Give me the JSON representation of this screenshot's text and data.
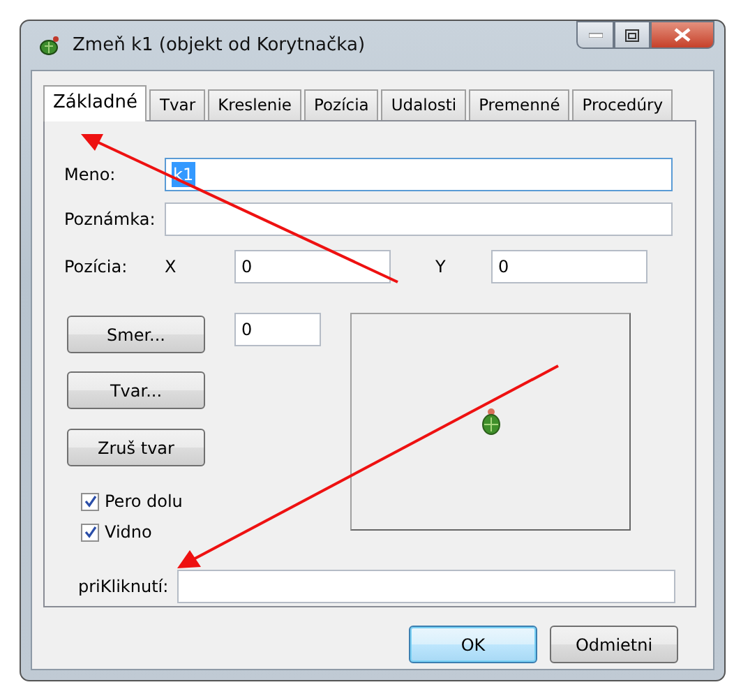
{
  "window": {
    "title": "Zmeň k1 (objekt od Korytnačka)"
  },
  "tabs": [
    {
      "label": "Základné",
      "selected": true
    },
    {
      "label": "Tvar",
      "selected": false
    },
    {
      "label": "Kreslenie",
      "selected": false
    },
    {
      "label": "Pozícia",
      "selected": false
    },
    {
      "label": "Udalosti",
      "selected": false
    },
    {
      "label": "Premenné",
      "selected": false
    },
    {
      "label": "Procedúry",
      "selected": false
    }
  ],
  "name": {
    "label": "Meno:",
    "value": "k1",
    "text_selected": true
  },
  "note": {
    "label": "Poznámka:"
  },
  "position": {
    "label": "Pozícia:",
    "x_label": "X",
    "x_value": "0",
    "y_label": "Y",
    "y_value": "0"
  },
  "direction": {
    "button": "Smer...",
    "value": "0"
  },
  "shape_button": "Tvar...",
  "clear_shape_button": "Zruš tvar",
  "checkboxes": [
    {
      "label": "Pero dolu",
      "checked": true
    },
    {
      "label": "Vidno",
      "checked": true
    }
  ],
  "on_click": {
    "label": "priKliknutí:"
  },
  "buttons": [
    {
      "label": "OK",
      "default": true
    },
    {
      "label": "Odmietni",
      "default": false
    }
  ]
}
